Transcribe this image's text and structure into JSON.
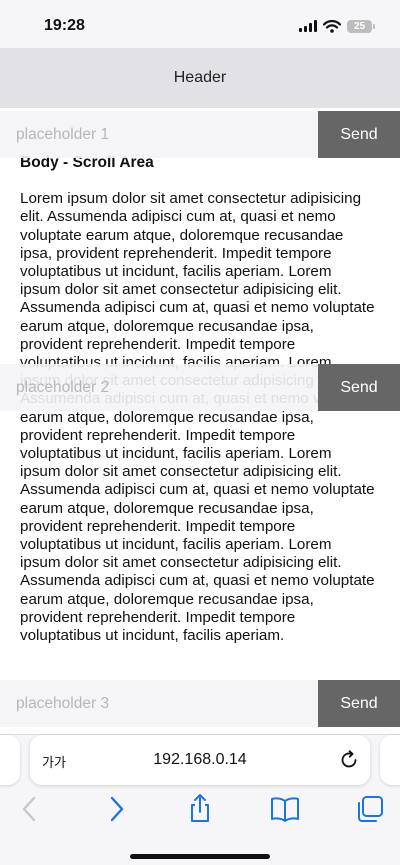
{
  "status_bar": {
    "time": "19:28",
    "battery": "25"
  },
  "header": {
    "title": "Header"
  },
  "body": {
    "title": "Body - Scroll Area",
    "text": "Lorem ipsum dolor sit amet consectetur adipisicing elit. Assumenda adipisci cum at, quasi et nemo voluptate earum atque, doloremque recusandae ipsa, provident reprehenderit. Impedit tempore voluptatibus ut incidunt, facilis aperiam. Lorem ipsum dolor sit amet consectetur adipisicing elit. Assumenda adipisci cum at, quasi et nemo voluptate earum atque, doloremque recusandae ipsa, provident reprehenderit. Impedit tempore voluptatibus ut incidunt, facilis aperiam. Lorem ipsum dolor sit amet consectetur adipisicing elit. Assumenda adipisci cum at, quasi et nemo voluptate earum atque, doloremque recusandae ipsa, provident reprehenderit. Impedit tempore voluptatibus ut incidunt, facilis aperiam. Lorem ipsum dolor sit amet consectetur adipisicing elit. Assumenda adipisci cum at, quasi et nemo voluptate earum atque, doloremque recusandae ipsa, provident reprehenderit. Impedit tempore voluptatibus ut incidunt, facilis aperiam. Lorem ipsum dolor sit amet consectetur adipisicing elit. Assumenda adipisci cum at, quasi et nemo voluptate earum atque, doloremque recusandae ipsa, provident reprehenderit. Impedit tempore voluptatibus ut incidunt, facilis aperiam."
  },
  "inputs": [
    {
      "placeholder": "placeholder 1",
      "button": "Send"
    },
    {
      "placeholder": "placeholder 2",
      "button": "Send"
    },
    {
      "placeholder": "placeholder 3",
      "button": "Send"
    }
  ],
  "browser": {
    "aa_label": "가가",
    "url": "192.168.0.14",
    "icons": [
      "reload-icon",
      "back-icon",
      "forward-icon",
      "share-icon",
      "bookmarks-icon",
      "tabs-icon"
    ]
  }
}
